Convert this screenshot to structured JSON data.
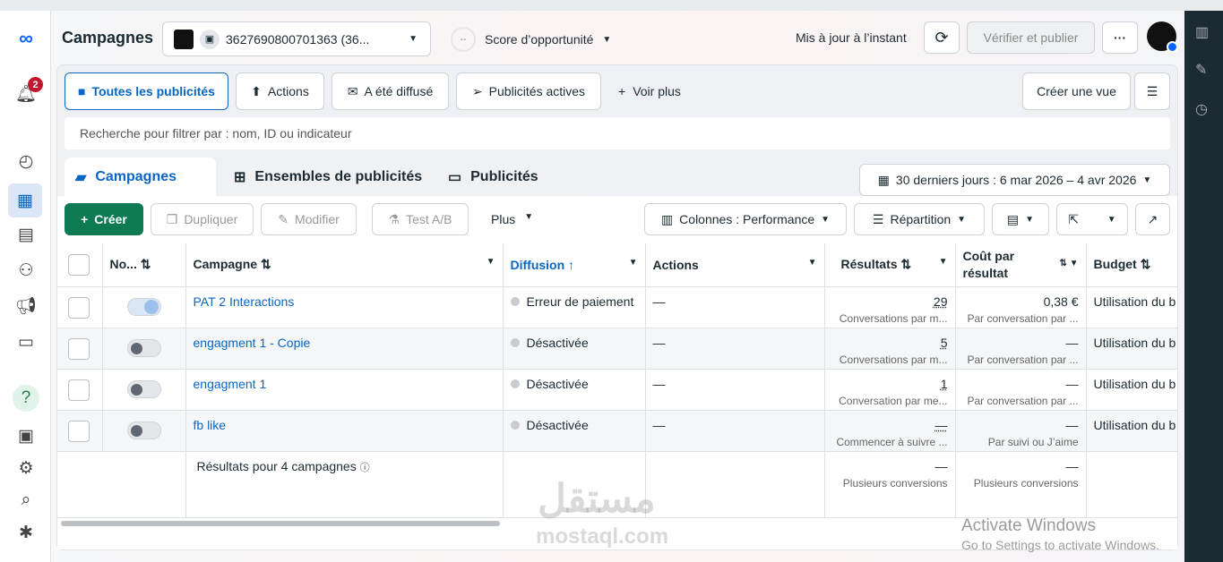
{
  "header": {
    "title": "Campagnes",
    "account": "3627690800701363 (36...",
    "score": "Score d’opportunité",
    "score_value": "--",
    "updated": "Mis à jour à l’instant",
    "verify_publish": "Vérifier et publier",
    "more": "···"
  },
  "sidebar": {
    "notification_count": "2"
  },
  "filters": {
    "items": [
      "Toutes les publicités",
      "Actions",
      "A été diffusé",
      "Publicités actives"
    ],
    "see_more": "Voir plus",
    "create_view": "Créer une vue"
  },
  "search": {
    "placeholder": "Recherche pour filtrer par : nom, ID ou indicateur"
  },
  "tabs": [
    "Campagnes",
    "Ensembles de publicités",
    "Publicités"
  ],
  "date_range": "30 derniers jours : 6 mar 2026 – 4 avr 2026",
  "toolbar": {
    "create": "Créer",
    "duplicate": "Dupliquer",
    "edit": "Modifier",
    "ab_test": "Test A/B",
    "more": "Plus",
    "columns": "Colonnes : Performance",
    "breakdown": "Répartition"
  },
  "table": {
    "headers": {
      "name_short": "No...",
      "campaign": "Campagne",
      "delivery": "Diffusion",
      "actions": "Actions",
      "results": "Résultats",
      "cost": "Coût par résultat",
      "budget": "Budget"
    },
    "rows": [
      {
        "name": "PAT 2 Interactions",
        "on": true,
        "delivery": "Erreur de paiement",
        "actions": "—",
        "results": "29",
        "results_sub": "Conversations par m...",
        "cost": "0,38 €",
        "cost_sub": "Par conversation par ...",
        "budget": "Utilisation du b"
      },
      {
        "name": "engagment 1 - Copie",
        "on": false,
        "delivery": "Désactivée",
        "actions": "—",
        "results": "5",
        "results_sub": "Conversations par m...",
        "cost": "—",
        "cost_sub": "Par conversation par ...",
        "budget": "Utilisation du b"
      },
      {
        "name": "engagment 1",
        "on": false,
        "delivery": "Désactivée",
        "actions": "—",
        "results": "1",
        "results_sub": "Conversation par me...",
        "cost": "—",
        "cost_sub": "Par conversation par ...",
        "budget": "Utilisation du b"
      },
      {
        "name": "fb like",
        "on": false,
        "delivery": "Désactivée",
        "actions": "—",
        "results": "—",
        "results_sub": "Commencer à suivre ...",
        "cost": "—",
        "cost_sub": "Par suivi ou J’aime",
        "budget": "Utilisation du b"
      }
    ],
    "summary": {
      "label": "Résultats pour 4 campagnes",
      "results": "—",
      "results_sub": "Plusieurs conversions",
      "cost": "—",
      "cost_sub": "Plusieurs conversions"
    }
  },
  "watermark": {
    "arabic": "مستقل",
    "latin": "mostaql.com"
  },
  "os_notice": {
    "title": "Activate Windows",
    "sub": "Go to Settings to activate Windows."
  }
}
